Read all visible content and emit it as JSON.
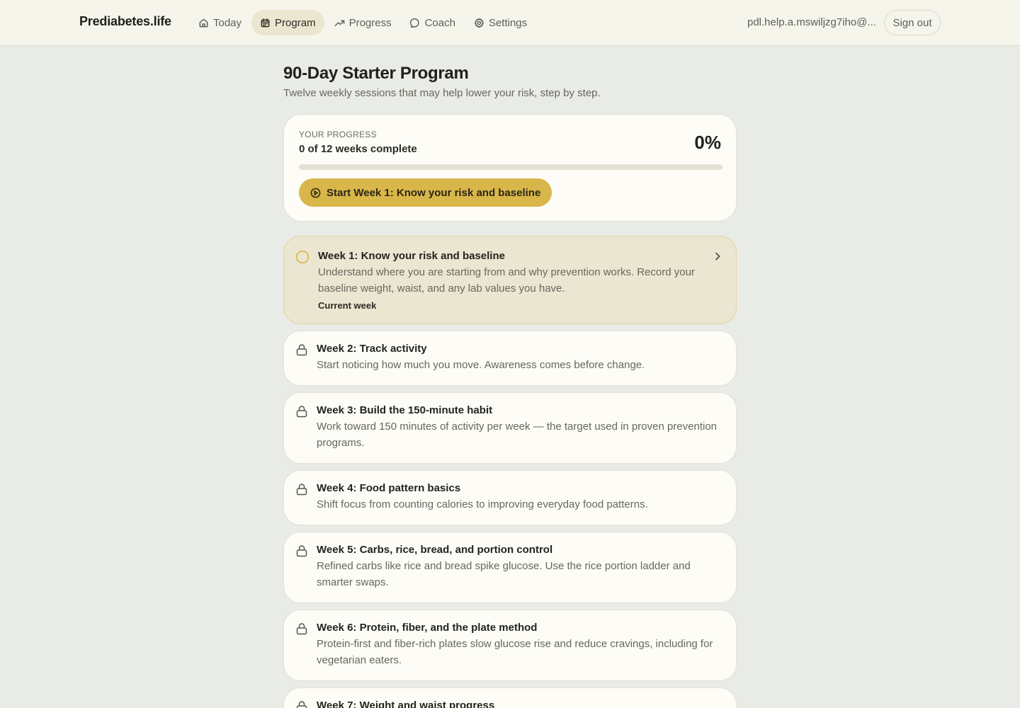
{
  "app": {
    "brand": "Prediabetes.life",
    "nav": [
      {
        "label": "Today",
        "icon": "home-icon"
      },
      {
        "label": "Program",
        "icon": "calendar-icon",
        "active": true
      },
      {
        "label": "Progress",
        "icon": "trending-up-icon"
      },
      {
        "label": "Coach",
        "icon": "chat-bubble-icon"
      },
      {
        "label": "Settings",
        "icon": "gear-icon"
      }
    ],
    "user_email": "pdl.help.a.mswiljzg7iho@...",
    "signout_label": "Sign out"
  },
  "page": {
    "title": "90-Day Starter Program",
    "subtitle": "Twelve weekly sessions that may help lower your risk, step by step."
  },
  "progress": {
    "label": "YOUR PROGRESS",
    "count_text": "0 of 12 weeks complete",
    "percent_text": "0%",
    "percent_value": 0,
    "start_button": "Start Week 1: Know your risk and baseline"
  },
  "weeks": [
    {
      "title": "Week 1: Know your risk and baseline",
      "desc": "Understand where you are starting from and why prevention works. Record your baseline weight, waist, and any lab values you have.",
      "badge": "Current week",
      "status": "current",
      "icon": "circle-icon"
    },
    {
      "title": "Week 2: Track activity",
      "desc": "Start noticing how much you move. Awareness comes before change.",
      "status": "locked",
      "icon": "lock-icon"
    },
    {
      "title": "Week 3: Build the 150-minute habit",
      "desc": "Work toward 150 minutes of activity per week — the target used in proven prevention programs.",
      "status": "locked",
      "icon": "lock-icon"
    },
    {
      "title": "Week 4: Food pattern basics",
      "desc": "Shift focus from counting calories to improving everyday food patterns.",
      "status": "locked",
      "icon": "lock-icon"
    },
    {
      "title": "Week 5: Carbs, rice, bread, and portion control",
      "desc": "Refined carbs like rice and bread spike glucose. Use the rice portion ladder and smarter swaps.",
      "status": "locked",
      "icon": "lock-icon"
    },
    {
      "title": "Week 6: Protein, fiber, and the plate method",
      "desc": "Protein-first and fiber-rich plates slow glucose rise and reduce cravings, including for vegetarian eaters.",
      "status": "locked",
      "icon": "lock-icon"
    },
    {
      "title": "Week 7: Weight and waist progress",
      "desc": "",
      "status": "locked",
      "icon": "lock-icon"
    }
  ],
  "colors": {
    "accent": "#d9b64a",
    "background": "#e9ebe6",
    "card": "#fdfcf6",
    "current_card": "#ebe6d1"
  }
}
